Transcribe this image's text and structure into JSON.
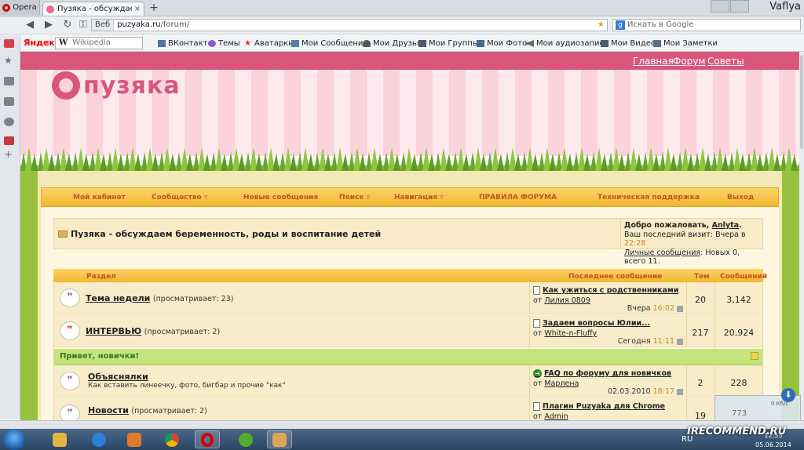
{
  "browser": {
    "menu_label": "Opera",
    "tab_title": "Пузяка - обсуждаем б...",
    "tab_close": "×",
    "new_tab": "+",
    "user": "Vaflya",
    "url_label": "Веб",
    "url_host": "puzyaka.ru",
    "url_path": "/forum/",
    "search_placeholder": "Искать в Google",
    "yandex_label": "Яндекс",
    "wiki_placeholder": "Wikipedia",
    "bookmarks": [
      "ВКонтакте",
      "Темы",
      "Аватарки",
      "Мои Сообщения",
      "Мои Друзья",
      "Мои Группы",
      "Мои Фото",
      "Мои аудиозаписи",
      "Мои Видео",
      "Мои Заметки"
    ]
  },
  "site": {
    "top_links": [
      "Главная",
      "Форум",
      "Советы"
    ],
    "logo_text": "пузяка",
    "menu": [
      "Мой кабинет",
      "Сообщество",
      "Новые сообщения",
      "Поиск",
      "Навигация",
      "ПРАВИЛА ФОРУМА",
      "Техническая поддержка",
      "Выход"
    ],
    "forum_title": "Пузяка - обсуждаем беременность, роды и воспитание детей",
    "welcome": {
      "greeting": "Добро пожаловать,",
      "username": "Anlyta",
      "last_visit_label": "Ваш последний визит: Вчера в",
      "last_visit_time": "22:28",
      "pm_link": "Личные сообщения",
      "pm_counts": ": Новых 0, всего 11."
    },
    "table_headers": {
      "section": "Раздел",
      "last_post": "Последнее сообщение",
      "topics": "Тем",
      "posts": "Сообщений"
    },
    "rows": [
      {
        "title": "Тема недели",
        "views": "(просматривает: 23)",
        "desc": "",
        "lp_title": "Как ужиться с родственниками",
        "lp_by": "от",
        "lp_user": "Лилия 0809",
        "lp_date": "Вчера",
        "lp_time": "16:02",
        "topics": "20",
        "posts": "3,142"
      },
      {
        "title": "ИНТЕРВЬЮ",
        "views": "(просматривает: 2)",
        "desc": "",
        "lp_title": "Задаем вопросы Юлии...",
        "lp_by": "от",
        "lp_user": "White-n-Fluffy",
        "lp_date": "Сегодня",
        "lp_time": "11:11",
        "topics": "217",
        "posts": "20,924"
      },
      {
        "title": "Объяснялки",
        "views": "",
        "desc": "Как вставить линеечку, фото, бигбар и прочие \"как\"",
        "lp_title": "FAQ по форуму для новичков",
        "lp_by": "от",
        "lp_user": "Марлена",
        "lp_date": "02.03.2010",
        "lp_time": "18:17",
        "topics": "2",
        "posts": "228"
      },
      {
        "title": "Новости",
        "views": "(просматривает: 2)",
        "desc": "",
        "lp_title": "Плагин Puzyaka для Chrome",
        "lp_by": "от",
        "lp_user": "Admin",
        "lp_date": "",
        "lp_time": "",
        "topics": "19",
        "posts": ""
      }
    ],
    "category": "Привет, новички!"
  },
  "download": {
    "value": "773",
    "kb": "0 Кб/с"
  },
  "taskbar": {
    "lang": "RU",
    "time": "12:53",
    "date": "05.06.2014",
    "watermark": "IRECOMMEND.RU"
  },
  "colors": {
    "accent": "#d9557a",
    "menu": "#f2b52f",
    "green": "#97c13c"
  }
}
